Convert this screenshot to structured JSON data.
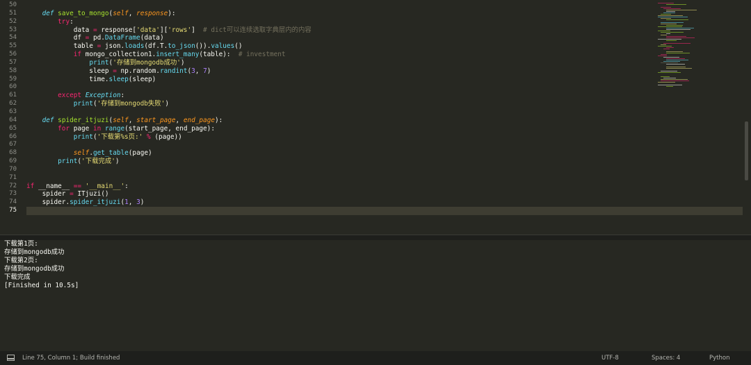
{
  "editor": {
    "current_line": 75,
    "lines": [
      {
        "n": "50",
        "code": ""
      },
      {
        "n": "51",
        "code": "    def save_to_mongo(self, response):"
      },
      {
        "n": "52",
        "code": "        try:"
      },
      {
        "n": "53",
        "code": "            data = response['data']['rows']  # dict可以连续选取字典层内的内容"
      },
      {
        "n": "54",
        "code": "            df = pd.DataFrame(data)"
      },
      {
        "n": "55",
        "code": "            table = json.loads(df.T.to_json()).values()"
      },
      {
        "n": "56",
        "code": "            if mongo_collection1.insert_many(table):  # investment"
      },
      {
        "n": "57",
        "code": "                print('存储到mongodb成功')"
      },
      {
        "n": "58",
        "code": "                sleep = np.random.randint(3, 7)"
      },
      {
        "n": "59",
        "code": "                time.sleep(sleep)"
      },
      {
        "n": "60",
        "code": ""
      },
      {
        "n": "61",
        "code": "        except Exception:"
      },
      {
        "n": "62",
        "code": "            print('存储到mongodb失败')"
      },
      {
        "n": "63",
        "code": ""
      },
      {
        "n": "64",
        "code": "    def spider_itjuzi(self, start_page, end_page):"
      },
      {
        "n": "65",
        "code": "        for page in range(start_page, end_page):"
      },
      {
        "n": "66",
        "code": "            print('下载第%s页:' % (page))"
      },
      {
        "n": "67",
        "code": ""
      },
      {
        "n": "68",
        "code": "            self.get_table(page)"
      },
      {
        "n": "69",
        "code": "        print('下载完成')"
      },
      {
        "n": "70",
        "code": ""
      },
      {
        "n": "71",
        "code": ""
      },
      {
        "n": "72",
        "code": "if __name__ == '__main__':"
      },
      {
        "n": "73",
        "code": "    spider = ITjuzi()"
      },
      {
        "n": "74",
        "code": "    spider.spider_itjuzi(1, 3)"
      },
      {
        "n": "75",
        "code": ""
      }
    ]
  },
  "output": {
    "lines": [
      "下载第1页:",
      "存储到mongodb成功",
      "下载第2页:",
      "存储到mongodb成功",
      "下载完成",
      "[Finished in 10.5s]"
    ]
  },
  "status": {
    "panel_icon": "panel-toggle-icon",
    "position": "Line 75, Column 1; Build finished",
    "encoding": "UTF-8",
    "indent": "Spaces: 4",
    "syntax": "Python"
  },
  "colors": {
    "background": "#272822",
    "keyword": "#f92672",
    "function": "#a6e22e",
    "string": "#e6db74",
    "comment": "#75715e",
    "number": "#ae81ff",
    "parameter": "#fd971f",
    "builtin": "#66d9ef"
  }
}
